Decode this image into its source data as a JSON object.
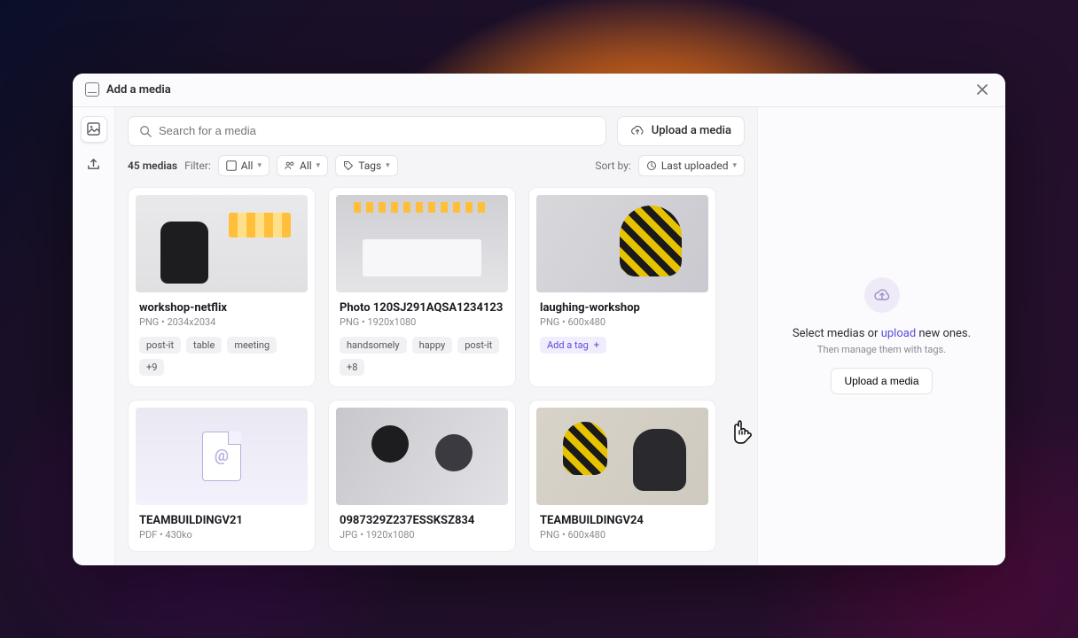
{
  "modal": {
    "title": "Add a media"
  },
  "search": {
    "placeholder": "Search for a media"
  },
  "upload_button": "Upload a media",
  "counts": {
    "media_total_label": "45 medias"
  },
  "filters": {
    "label": "Filter:",
    "type_all": "All",
    "people_all": "All",
    "tags": "Tags"
  },
  "sort": {
    "label": "Sort by:",
    "value": "Last uploaded"
  },
  "cards": [
    {
      "title": "workshop-netflix",
      "meta": "PNG • 2034x2034",
      "tags": [
        "post-it",
        "table",
        "meeting"
      ],
      "more": "+9"
    },
    {
      "title": "Photo 120SJ291AQSA1234123",
      "meta": "PNG • 1920x1080",
      "tags": [
        "handsomely",
        "happy",
        "post-it"
      ],
      "more": "+8"
    },
    {
      "title": "laughing-workshop",
      "meta": "PNG • 600x480",
      "add_tag": "Add a tag"
    },
    {
      "title": "TEAMBUILDINGV21",
      "meta": "PDF • 430ko"
    },
    {
      "title": "0987329Z237ESSKSZ834",
      "meta": "JPG • 1920x1080"
    },
    {
      "title": "TEAMBUILDINGV24",
      "meta": "PNG • 600x480"
    }
  ],
  "sidepanel": {
    "msg_pre": "Select medias or ",
    "msg_link": "upload",
    "msg_post": " new ones.",
    "sub": "Then manage them with tags.",
    "button": "Upload a media"
  }
}
